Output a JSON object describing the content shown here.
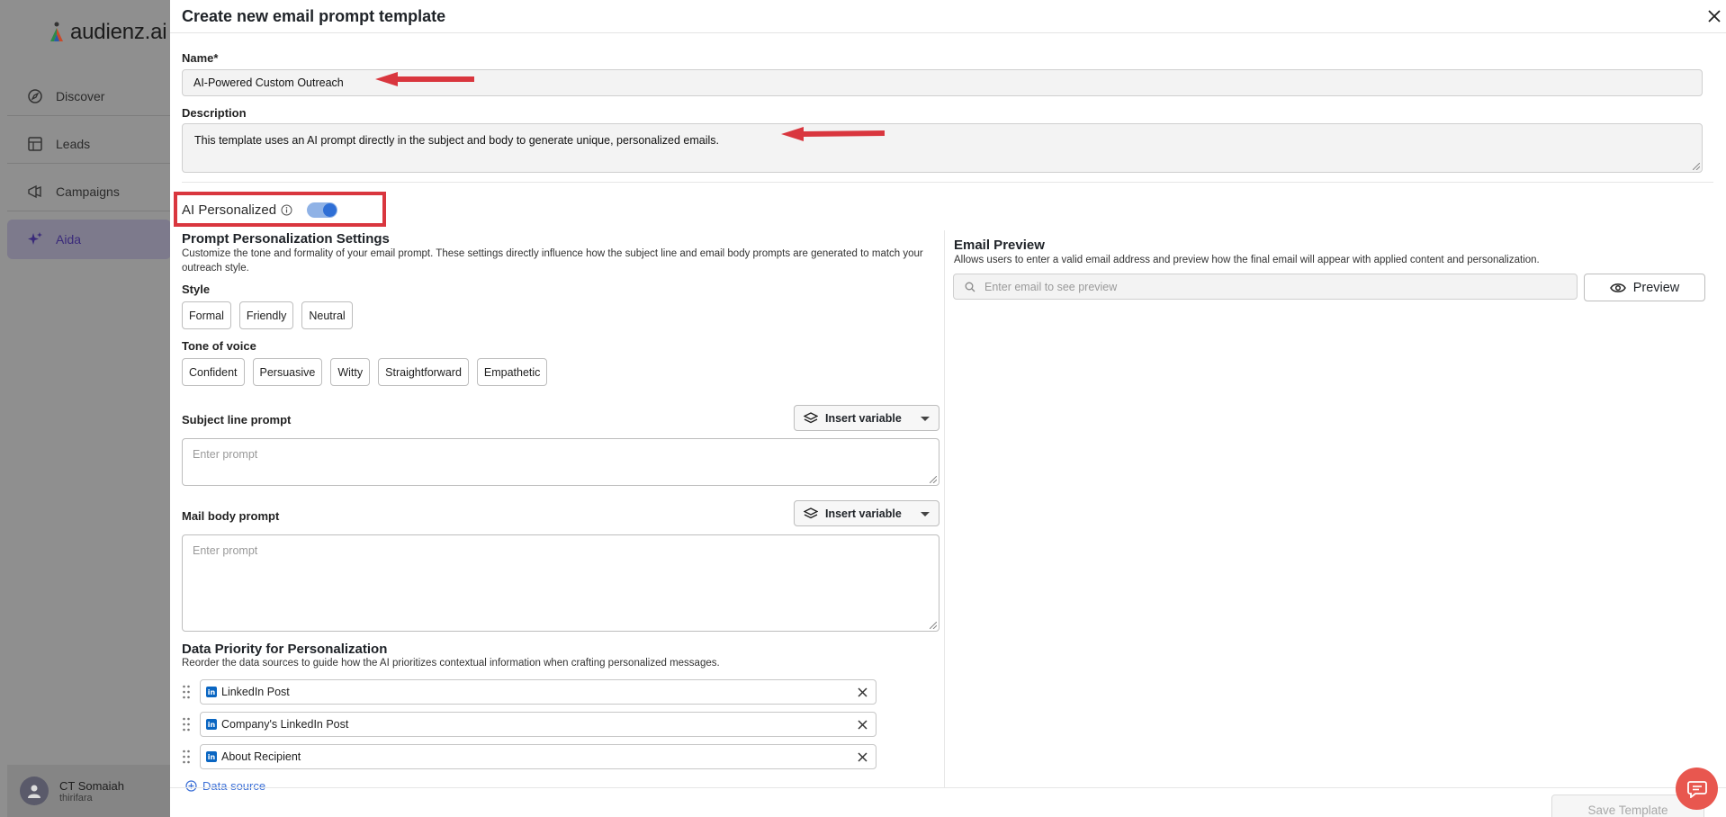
{
  "app": {
    "logo_text": "audienz.ai",
    "nav": [
      {
        "label": "Discover",
        "icon": "compass-icon"
      },
      {
        "label": "Leads",
        "icon": "table-icon"
      },
      {
        "label": "Campaigns",
        "icon": "megaphone-icon"
      },
      {
        "label": "Aida",
        "icon": "sparkle-icon",
        "active": true
      }
    ],
    "user": {
      "name": "CT Somaiah",
      "subtitle": "thirifara"
    }
  },
  "modal": {
    "title": "Create new email prompt template",
    "name_label": "Name*",
    "name_value": "AI-Powered Custom Outreach",
    "description_label": "Description",
    "description_value": "This template uses an AI prompt directly in the subject and body to generate unique, personalized emails.",
    "ai_personalized_label": "AI Personalized",
    "ai_personalized_on": true,
    "prompt_settings": {
      "title": "Prompt Personalization Settings",
      "description": "Customize the tone and formality of your email prompt. These settings directly influence how the subject line and email body prompts are generated to match your outreach style.",
      "style_label": "Style",
      "style_options": [
        "Formal",
        "Friendly",
        "Neutral"
      ],
      "tone_label": "Tone of voice",
      "tone_options": [
        "Confident",
        "Persuasive",
        "Witty",
        "Straightforward",
        "Empathetic"
      ]
    },
    "subject_prompt": {
      "label": "Subject line prompt",
      "insert_label": "Insert variable",
      "placeholder": "Enter prompt"
    },
    "body_prompt": {
      "label": "Mail body prompt",
      "insert_label": "Insert variable",
      "placeholder": "Enter prompt"
    },
    "data_priority": {
      "title": "Data Priority for Personalization",
      "description": "Reorder the data sources to guide how the AI prioritizes contextual information when crafting personalized messages.",
      "items": [
        "LinkedIn Post",
        "Company's LinkedIn Post",
        "About Recipient"
      ],
      "add_source_label": "Data source"
    },
    "email_preview": {
      "title": "Email Preview",
      "description": "Allows users to enter a valid email address and preview how the final email will appear with applied content and personalization.",
      "placeholder": "Enter email to see preview",
      "preview_label": "Preview"
    },
    "save_label": "Save Template"
  },
  "colors": {
    "annotation_red": "#d9363e",
    "accent_blue": "#2f6fd6",
    "chat_fab": "#e8574f"
  }
}
